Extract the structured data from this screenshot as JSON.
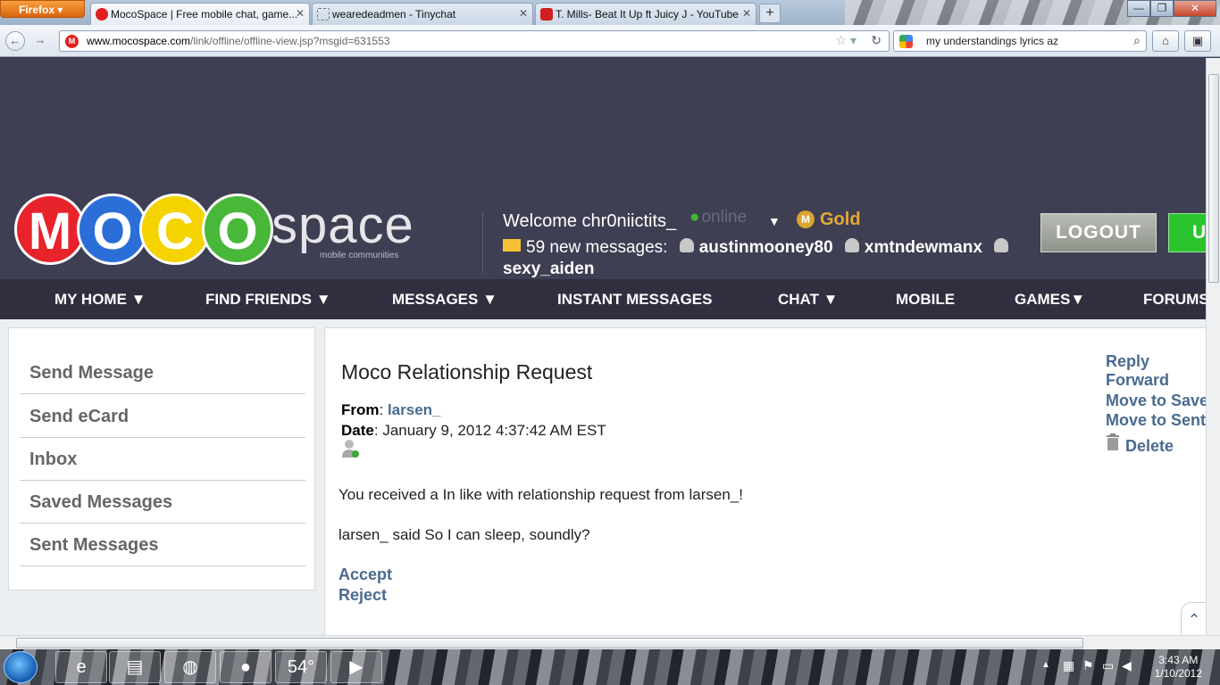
{
  "browser": {
    "app_button": "Firefox",
    "tabs": [
      {
        "title": "MocoSpace | Free mobile chat, game...",
        "active": true,
        "icon": "mocospace-icon"
      },
      {
        "title": "wearedeadmen - Tinychat",
        "active": false,
        "icon": "page-icon"
      },
      {
        "title": "T. Mills- Beat It Up ft Juicy J - YouTube",
        "active": false,
        "icon": "youtube-icon"
      }
    ],
    "new_tab": "+",
    "window_controls": [
      "—",
      "❐",
      "✕"
    ],
    "url_host": "www.mocospace.com",
    "url_path": "/link/offline/offline-view.jsp?msgid=631553",
    "search_query": "my understandings lyrics az"
  },
  "site": {
    "logo_letters": [
      "M",
      "O",
      "C",
      "O"
    ],
    "logo_word": "space",
    "logo_tagline": "mobile communities",
    "welcome": "Welcome chr0niictits_",
    "status": "online",
    "gold": "Gold",
    "new_messages": "59 new messages:",
    "senders": [
      "austinmooney80",
      "xmtndewmanx"
    ],
    "sender_overflow": "sexy_aiden",
    "logout": "LOGOUT",
    "green_button": "U"
  },
  "menu": [
    "MY HOME ▼",
    "FIND FRIENDS ▼",
    "MESSAGES ▼",
    "INSTANT MESSAGES",
    "CHAT ▼",
    "MOBILE",
    "GAMES▼",
    "FORUMS"
  ],
  "left_nav": [
    "Send Message",
    "Send eCard",
    "Inbox",
    "Saved Messages",
    "Sent Messages"
  ],
  "message": {
    "title": "Moco Relationship Request",
    "from_label": "From",
    "from_value": "larsen_",
    "date_label": "Date",
    "date_value": "January 9, 2012 4:37:42 AM EST",
    "body1": "You received a In like with relationship request from larsen_!",
    "body2": "larsen_ said So I can sleep, soundly?",
    "accept": "Accept",
    "reject": "Reject",
    "actions": [
      "Reply",
      "Forward",
      "Move to Saved",
      "Move to Sent"
    ],
    "delete": "Delete"
  },
  "taskbar": {
    "weather": "54°",
    "time": "3:43 AM",
    "date": "1/10/2012"
  },
  "colors": {
    "header_bg": "#3f3f53",
    "menu_bg": "#2f2f40",
    "link": "#4a6a8f",
    "gold": "#e3a93a"
  }
}
